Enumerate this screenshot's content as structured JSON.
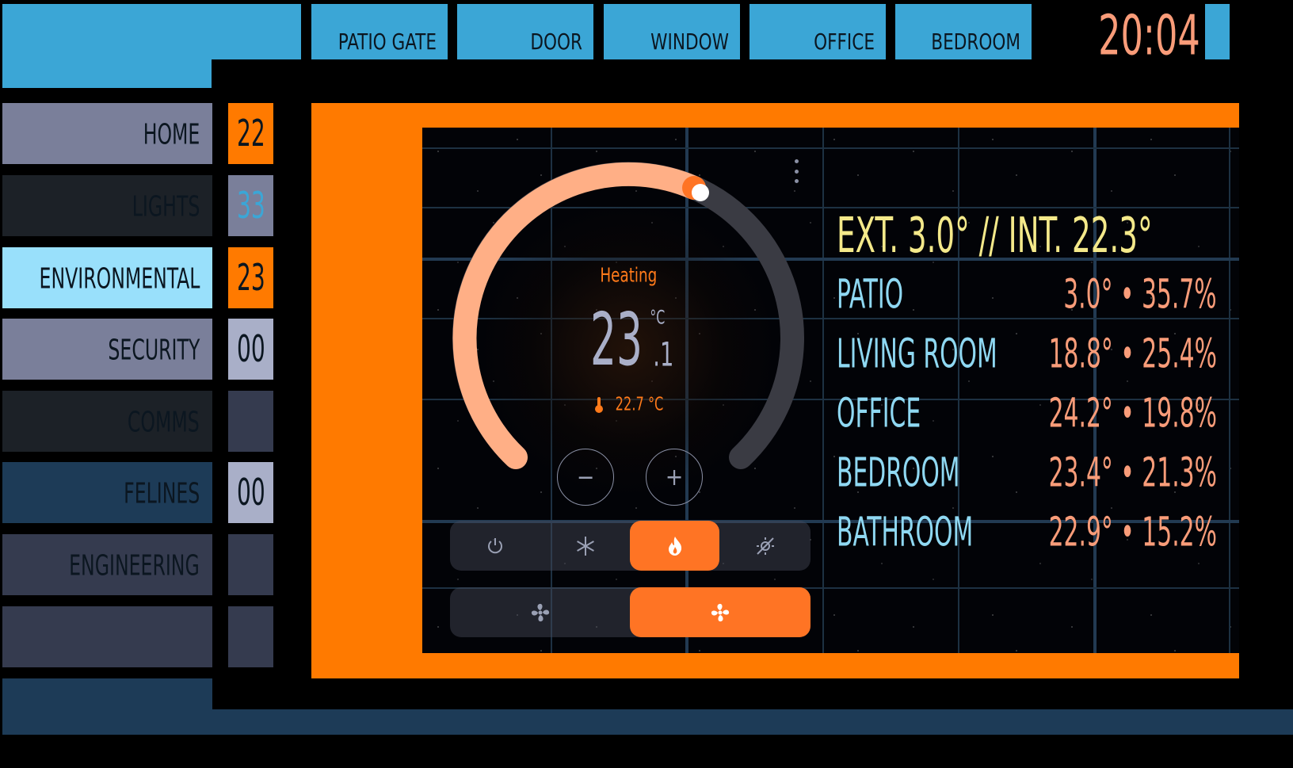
{
  "colors": {
    "accent_blue": "#3ba6d6",
    "accent_orange": "#ff7a00",
    "lavender": "#7a7f9a",
    "light_cyan": "#99e0fb",
    "navy": "#1d3b57",
    "slate": "#353b4f",
    "dark": "#1c2127"
  },
  "top_nav": {
    "items": [
      {
        "label": "PATIO GATE"
      },
      {
        "label": "DOOR"
      },
      {
        "label": "WINDOW"
      },
      {
        "label": "OFFICE"
      },
      {
        "label": "BEDROOM"
      }
    ]
  },
  "clock": "20:04",
  "sidebar": {
    "items": [
      {
        "label": "HOME",
        "badge": "22",
        "active": false
      },
      {
        "label": "LIGHTS",
        "badge": "33",
        "active": false
      },
      {
        "label": "ENVIRONMENTAL",
        "badge": "23",
        "active": true
      },
      {
        "label": "SECURITY",
        "badge": "00",
        "active": false
      },
      {
        "label": "COMMS",
        "badge": "",
        "active": false
      },
      {
        "label": "FELINES",
        "badge": "00",
        "active": false
      },
      {
        "label": "ENGINEERING",
        "badge": "",
        "active": false
      },
      {
        "label": "",
        "badge": "",
        "active": false
      }
    ]
  },
  "thermostat": {
    "status": "Heating",
    "target_whole": "23",
    "target_decimal": ".1",
    "unit": "°C",
    "current": "22.7 °C",
    "decrease_label": "−",
    "increase_label": "+",
    "modes": [
      {
        "icon": "power-icon",
        "active": false
      },
      {
        "icon": "snowflake-icon",
        "active": false
      },
      {
        "icon": "flame-icon",
        "active": true
      },
      {
        "icon": "heat-off-icon",
        "active": false
      }
    ],
    "fan_modes": [
      {
        "icon": "fan-icon",
        "active": false
      },
      {
        "icon": "fan-icon",
        "active": true
      }
    ]
  },
  "sensors": {
    "header": "EXT. 3.0° // INT. 22.3°",
    "rows": [
      {
        "name": "PATIO",
        "value": "3.0° • 35.7%"
      },
      {
        "name": "LIVING ROOM",
        "value": "18.8° • 25.4%"
      },
      {
        "name": "OFFICE",
        "value": "24.2° • 19.8%"
      },
      {
        "name": "BEDROOM",
        "value": "23.4° • 21.3%"
      },
      {
        "name": "BATHROOM",
        "value": "22.9° • 15.2%"
      }
    ]
  }
}
